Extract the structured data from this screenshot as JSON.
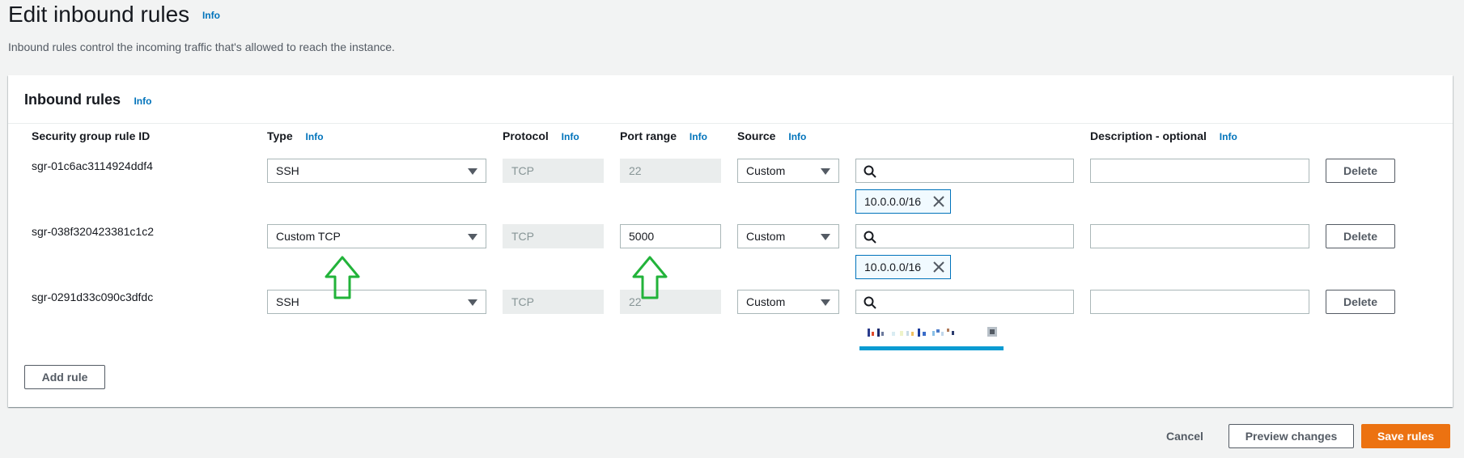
{
  "page": {
    "title": "Edit inbound rules",
    "title_info": "Info",
    "description": "Inbound rules control the incoming traffic that's allowed to reach the instance."
  },
  "panel": {
    "title": "Inbound rules",
    "title_info": "Info",
    "columns": {
      "rule_id": "Security group rule ID",
      "type": "Type",
      "type_info": "Info",
      "protocol": "Protocol",
      "protocol_info": "Info",
      "port_range": "Port range",
      "port_range_info": "Info",
      "source": "Source",
      "source_info": "Info",
      "description": "Description - optional",
      "description_info": "Info"
    },
    "rules": [
      {
        "id": "sgr-01c6ac3114924ddf4",
        "type": "SSH",
        "protocol": "TCP",
        "port": "22",
        "source": "Custom",
        "cidr": "10.0.0.0/16",
        "description": "",
        "delete_label": "Delete"
      },
      {
        "id": "sgr-038f320423381c1c2",
        "type": "Custom TCP",
        "protocol": "TCP",
        "port": "5000",
        "source": "Custom",
        "cidr": "10.0.0.0/16",
        "description": "",
        "delete_label": "Delete"
      },
      {
        "id": "sgr-0291d33c090c3dfdc",
        "type": "SSH",
        "protocol": "TCP",
        "port": "22",
        "source": "Custom",
        "cidr": "",
        "description": "",
        "delete_label": "Delete"
      }
    ],
    "add_rule_label": "Add rule"
  },
  "footer": {
    "cancel_label": "Cancel",
    "preview_label": "Preview changes",
    "save_label": "Save rules"
  },
  "colors": {
    "accent": "#0073bb",
    "primary_button": "#ec7211",
    "annotation_arrow": "#22b33a"
  },
  "icons": [
    "search-icon",
    "close-icon",
    "caret-down-icon",
    "arrow-up-annotation"
  ]
}
